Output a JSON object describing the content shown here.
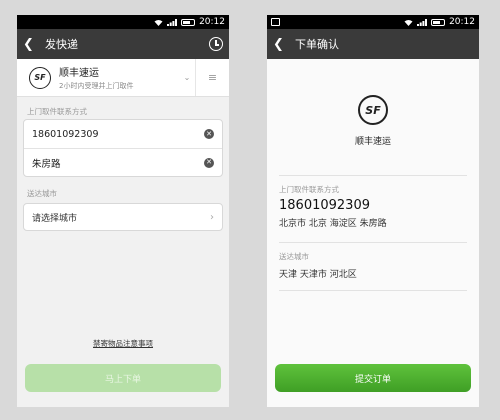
{
  "status_bar": {
    "time": "20:12"
  },
  "left_screen": {
    "title": "发快递",
    "courier": {
      "logo_text": "SF",
      "name": "顺丰速运",
      "description": "2小时内受理并上门取件"
    },
    "pickup_section_label": "上门取件联系方式",
    "phone_value": "18601092309",
    "address_value": "朱房路",
    "destination_section_label": "送达城市",
    "city_placeholder": "请选择城市",
    "notice_link": "禁寄物品注意事项",
    "submit_button": "马上下单"
  },
  "right_screen": {
    "title": "下单确认",
    "courier": {
      "logo_text": "SF",
      "name": "顺丰速运"
    },
    "pickup_label": "上门取件联系方式",
    "phone": "18601092309",
    "pickup_address": "北京市 北京 海淀区 朱房路",
    "destination_label": "送达城市",
    "destination": "天津 天津市 河北区",
    "submit_button": "提交订单"
  },
  "colors": {
    "title_bar": "#3a3a3a",
    "accent_green": "#4caf30",
    "disabled_green": "#b7e0a8"
  }
}
